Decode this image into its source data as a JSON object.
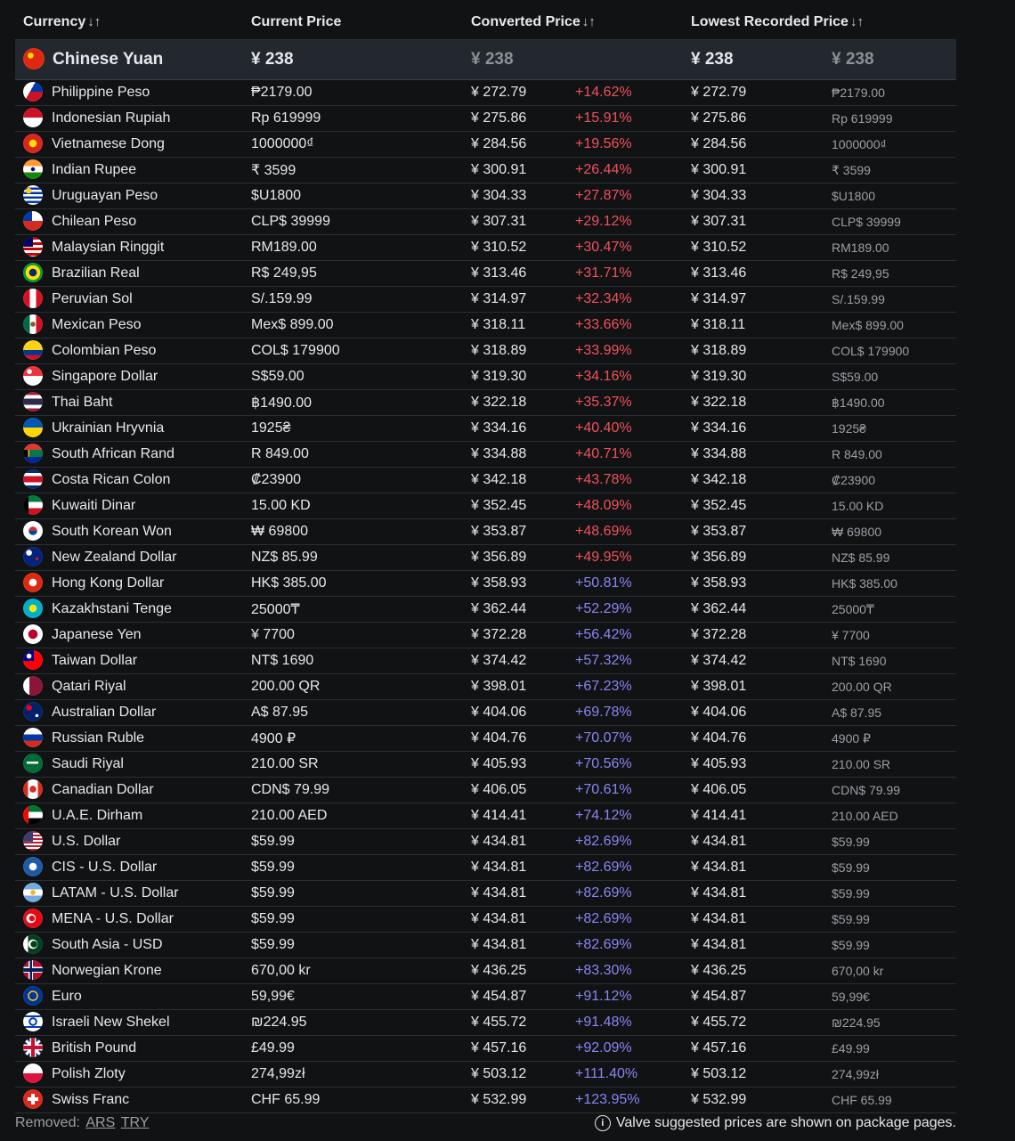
{
  "header": {
    "currency": "Currency",
    "current_price": "Current Price",
    "converted_price": "Converted Price",
    "lowest_recorded": "Lowest Recorded Price",
    "sort_icon": "↓↑"
  },
  "base": {
    "name": "Chinese Yuan",
    "price": "¥ 238",
    "converted": "¥ 238",
    "lowest": "¥ 238",
    "lowest_orig": "¥ 238",
    "flag_bg": "radial-gradient(circle at 35% 35%, #ffde00 0 3px, transparent 3.5px), #de2910"
  },
  "rows": [
    {
      "name": "Philippine Peso",
      "price": "₱2179.00",
      "converted": "¥ 272.79",
      "pct": "+14.62%",
      "lowest": "¥ 272.79",
      "lowest_orig": "₱2179.00",
      "color": "red",
      "flag_bg": "linear-gradient(120deg, #fff 0 40%, transparent 40%), linear-gradient(to bottom, #0038a8 50%, #ce1126 50%)"
    },
    {
      "name": "Indonesian Rupiah",
      "price": "Rp 619999",
      "converted": "¥ 275.86",
      "pct": "+15.91%",
      "lowest": "¥ 275.86",
      "lowest_orig": "Rp 619999",
      "color": "red",
      "flag_bg": "linear-gradient(to bottom, #ce1126 50%, #fff 50%)"
    },
    {
      "name": "Vietnamese Dong",
      "price": "1000000₫",
      "converted": "¥ 284.56",
      "pct": "+19.56%",
      "lowest": "¥ 284.56",
      "lowest_orig": "1000000₫",
      "color": "red",
      "flag_bg": "radial-gradient(circle, #ffde00 0 4px, transparent 4.5px), #da251d"
    },
    {
      "name": "Indian Rupee",
      "price": "₹ 3599",
      "converted": "¥ 300.91",
      "pct": "+26.44%",
      "lowest": "¥ 300.91",
      "lowest_orig": "₹ 3599",
      "color": "red",
      "flag_bg": "radial-gradient(circle, #06038d 0 2px, transparent 2.5px), linear-gradient(to bottom, #ff9933 33%, #fff 33% 66%, #138808 66%)"
    },
    {
      "name": "Uruguayan Peso",
      "price": "$U1800",
      "converted": "¥ 304.33",
      "pct": "+27.87%",
      "lowest": "¥ 304.33",
      "lowest_orig": "$U1800",
      "color": "red",
      "flag_bg": "radial-gradient(circle at 28% 28%, #fcd116 0 3px, transparent 3.5px), repeating-linear-gradient(to bottom, #fff 0 2.5px, #0038a8 2.5px 5px)"
    },
    {
      "name": "Chilean Peso",
      "price": "CLP$ 39999",
      "converted": "¥ 307.31",
      "pct": "+29.12%",
      "lowest": "¥ 307.31",
      "lowest_orig": "CLP$ 39999",
      "color": "red",
      "flag_bg": "linear-gradient(to right, #0039a6 45%, transparent 45%) top / 100% 50% no-repeat, linear-gradient(to bottom, #fff 50%, #d52b1e 50%)"
    },
    {
      "name": "Malaysian Ringgit",
      "price": "RM189.00",
      "converted": "¥ 310.52",
      "pct": "+30.47%",
      "lowest": "¥ 310.52",
      "lowest_orig": "RM189.00",
      "color": "red",
      "flag_bg": "linear-gradient(to right, #010066 50%, transparent 50%) top / 100% 50% no-repeat, repeating-linear-gradient(to bottom, #cc0001 0 3px, #fff 3px 6px)"
    },
    {
      "name": "Brazilian Real",
      "price": "R$ 249,95",
      "converted": "¥ 313.46",
      "pct": "+31.71%",
      "lowest": "¥ 313.46",
      "lowest_orig": "R$ 249,95",
      "color": "red",
      "flag_bg": "radial-gradient(circle, #002776 0 4px, #fedf00 4.5px 8px, #009c3b 8.5px)"
    },
    {
      "name": "Peruvian Sol",
      "price": "S/.159.99",
      "converted": "¥ 314.97",
      "pct": "+32.34%",
      "lowest": "¥ 314.97",
      "lowest_orig": "S/.159.99",
      "color": "red",
      "flag_bg": "linear-gradient(to right, #d91023 33%, #fff 33% 66%, #d91023 66%)"
    },
    {
      "name": "Mexican Peso",
      "price": "Mex$ 899.00",
      "converted": "¥ 318.11",
      "pct": "+33.66%",
      "lowest": "¥ 318.11",
      "lowest_orig": "Mex$ 899.00",
      "color": "red",
      "flag_bg": "radial-gradient(circle, #8b5a2b 0 2.5px, transparent 3px), linear-gradient(to right, #006847 33%, #fff 33% 66%, #ce1126 66%)"
    },
    {
      "name": "Colombian Peso",
      "price": "COL$ 179900",
      "converted": "¥ 318.89",
      "pct": "+33.99%",
      "lowest": "¥ 318.89",
      "lowest_orig": "COL$ 179900",
      "color": "red",
      "flag_bg": "linear-gradient(to bottom, #fcd116 50%, #003893 50% 75%, #ce1126 75%)"
    },
    {
      "name": "Singapore Dollar",
      "price": "S$59.00",
      "converted": "¥ 319.30",
      "pct": "+34.16%",
      "lowest": "¥ 319.30",
      "lowest_orig": "S$59.00",
      "color": "red",
      "flag_bg": "radial-gradient(circle at 32% 28%, #fff 0 2.5px, transparent 3px), linear-gradient(to bottom, #ef3340 50%, #fff 50%)"
    },
    {
      "name": "Thai Baht",
      "price": "฿1490.00",
      "converted": "¥ 322.18",
      "pct": "+35.37%",
      "lowest": "¥ 322.18",
      "lowest_orig": "฿1490.00",
      "color": "red",
      "flag_bg": "linear-gradient(to bottom, #a51931 16%, #fff 16% 33%, #2d2a4a 33% 66%, #fff 66% 83%, #a51931 83%)"
    },
    {
      "name": "Ukrainian Hryvnia",
      "price": "1925₴",
      "converted": "¥ 334.16",
      "pct": "+40.40%",
      "lowest": "¥ 334.16",
      "lowest_orig": "1925₴",
      "color": "red",
      "flag_bg": "linear-gradient(to bottom, #0057b7 50%, #ffd700 50%)"
    },
    {
      "name": "South African Rand",
      "price": "R 849.00",
      "converted": "¥ 334.88",
      "pct": "+40.71%",
      "lowest": "¥ 334.88",
      "lowest_orig": "R 849.00",
      "color": "red",
      "flag_bg": "linear-gradient(to right, #000 0 25%, #ffb612 25% 32%, #007a4d 32%) center / 100% 36% no-repeat, linear-gradient(to bottom, #de3831 50%, #002395 50%)"
    },
    {
      "name": "Costa Rican Colon",
      "price": "₡23900",
      "converted": "¥ 342.18",
      "pct": "+43.78%",
      "lowest": "¥ 342.18",
      "lowest_orig": "₡23900",
      "color": "red",
      "flag_bg": "linear-gradient(to bottom, #002b7f 18%, #fff 18% 33%, #ce1126 33% 66%, #fff 66% 82%, #002b7f 82%)"
    },
    {
      "name": "Kuwaiti Dinar",
      "price": "15.00 KD",
      "converted": "¥ 352.45",
      "pct": "+48.09%",
      "lowest": "¥ 352.45",
      "lowest_orig": "15.00 KD",
      "color": "red",
      "flag_bg": "linear-gradient(to right, #000 28%, transparent 28%), linear-gradient(to bottom, #007a3d 33%, #fff 33% 66%, #ce1126 66%)"
    },
    {
      "name": "South Korean Won",
      "price": "₩ 69800",
      "converted": "¥ 353.87",
      "pct": "+48.69%",
      "lowest": "¥ 353.87",
      "lowest_orig": "₩ 69800",
      "color": "red",
      "flag_bg": "radial-gradient(circle, transparent 0 4.5px, #fff 5px), linear-gradient(to bottom, #cd2e3a 50%, #0047a0 50%)"
    },
    {
      "name": "New Zealand Dollar",
      "price": "NZ$ 85.99",
      "converted": "¥ 356.89",
      "pct": "+49.95%",
      "lowest": "¥ 356.89",
      "lowest_orig": "NZ$ 85.99",
      "color": "red",
      "flag_bg": "radial-gradient(circle at 70% 60%, #cc142b 0 1.5px, transparent 2px), radial-gradient(circle at 30% 30%, #fff 0 3px, transparent 3.5px), #00247d"
    },
    {
      "name": "Hong Kong Dollar",
      "price": "HK$ 385.00",
      "converted": "¥ 358.93",
      "pct": "+50.81%",
      "lowest": "¥ 358.93",
      "lowest_orig": "HK$ 385.00",
      "color": "blue",
      "flag_bg": "radial-gradient(circle, #fff 0 4px, transparent 4.5px), #de2910"
    },
    {
      "name": "Kazakhstani Tenge",
      "price": "25000₸",
      "converted": "¥ 362.44",
      "pct": "+52.29%",
      "lowest": "¥ 362.44",
      "lowest_orig": "25000₸",
      "color": "blue",
      "flag_bg": "radial-gradient(circle, #ffe700 0 4px, transparent 4.5px), #00afca"
    },
    {
      "name": "Japanese Yen",
      "price": "¥ 7700",
      "converted": "¥ 372.28",
      "pct": "+56.42%",
      "lowest": "¥ 372.28",
      "lowest_orig": "¥ 7700",
      "color": "blue",
      "flag_bg": "radial-gradient(circle, #bc002d 0 5px, #fff 5.5px)"
    },
    {
      "name": "Taiwan Dollar",
      "price": "NT$ 1690",
      "converted": "¥ 374.42",
      "pct": "+57.32%",
      "lowest": "¥ 374.42",
      "lowest_orig": "NT$ 1690",
      "color": "blue",
      "flag_bg": "radial-gradient(circle at 30% 30%, #fff 0 2.5px, transparent 3px), linear-gradient(to right, #000095 55%, transparent 55%) top / 100% 55% no-repeat, #fe0000"
    },
    {
      "name": "Qatari Riyal",
      "price": "200.00 QR",
      "converted": "¥ 398.01",
      "pct": "+67.23%",
      "lowest": "¥ 398.01",
      "lowest_orig": "200.00 QR",
      "color": "blue",
      "flag_bg": "linear-gradient(to right, #fff 32%, #8a1538 32%)"
    },
    {
      "name": "Australian Dollar",
      "price": "A$ 87.95",
      "converted": "¥ 404.06",
      "pct": "+69.78%",
      "lowest": "¥ 404.06",
      "lowest_orig": "A$ 87.95",
      "color": "blue",
      "flag_bg": "radial-gradient(circle at 70% 70%, #fff 0 1.5px, transparent 2px), radial-gradient(circle at 30% 30%, #e4002b 0 3px, transparent 3.5px), #012169"
    },
    {
      "name": "Russian Ruble",
      "price": "4900 ₽",
      "converted": "¥ 404.76",
      "pct": "+70.07%",
      "lowest": "¥ 404.76",
      "lowest_orig": "4900 ₽",
      "color": "blue",
      "flag_bg": "linear-gradient(to bottom, #fff 33%, #0039a6 33% 66%, #d52b1e 66%)"
    },
    {
      "name": "Saudi Riyal",
      "price": "210.00 SR",
      "converted": "¥ 405.93",
      "pct": "+70.56%",
      "lowest": "¥ 405.93",
      "lowest_orig": "210.00 SR",
      "color": "blue",
      "flag_bg": "linear-gradient(to bottom, transparent 40%, #fff 40% 52%, transparent 52%) center / 60% 100% no-repeat, #006c35"
    },
    {
      "name": "Canadian Dollar",
      "price": "CDN$ 79.99",
      "converted": "¥ 406.05",
      "pct": "+70.61%",
      "lowest": "¥ 406.05",
      "lowest_orig": "CDN$ 79.99",
      "color": "blue",
      "flag_bg": "radial-gradient(circle, #d52b1e 0 3.5px, transparent 4px), linear-gradient(to right, #d52b1e 25%, #fff 25% 75%, #d52b1e 75%)"
    },
    {
      "name": "U.A.E. Dirham",
      "price": "210.00 AED",
      "converted": "¥ 414.41",
      "pct": "+74.12%",
      "lowest": "¥ 414.41",
      "lowest_orig": "210.00 AED",
      "color": "blue",
      "flag_bg": "linear-gradient(to right, #ff0000 28%, transparent 28%), linear-gradient(to bottom, #00732f 33%, #fff 33% 66%, #000 66%)"
    },
    {
      "name": "U.S. Dollar",
      "price": "$59.99",
      "converted": "¥ 434.81",
      "pct": "+82.69%",
      "lowest": "¥ 434.81",
      "lowest_orig": "$59.99",
      "color": "blue",
      "flag_bg": "linear-gradient(to right, #3c3b6e 50%, transparent 50%) top / 100% 54% no-repeat, repeating-linear-gradient(to bottom, #b22234 0 2px, #fff 2px 4px)"
    },
    {
      "name": "CIS - U.S. Dollar",
      "price": "$59.99",
      "converted": "¥ 434.81",
      "pct": "+82.69%",
      "lowest": "¥ 434.81",
      "lowest_orig": "$59.99",
      "color": "blue",
      "flag_bg": "radial-gradient(circle, #fff 0 4px, transparent 4.5px), #1e5aa8"
    },
    {
      "name": "LATAM - U.S. Dollar",
      "price": "$59.99",
      "converted": "¥ 434.81",
      "pct": "+82.69%",
      "lowest": "¥ 434.81",
      "lowest_orig": "$59.99",
      "color": "blue",
      "flag_bg": "radial-gradient(circle, #f6b40e 0 2.5px, transparent 3px), linear-gradient(to bottom, #74acdf 33%, #fff 33% 66%, #74acdf 66%)"
    },
    {
      "name": "MENA - U.S. Dollar",
      "price": "$59.99",
      "converted": "¥ 434.81",
      "pct": "+82.69%",
      "lowest": "¥ 434.81",
      "lowest_orig": "$59.99",
      "color": "blue",
      "flag_bg": "radial-gradient(circle at 45% 50%, #e30a17 0 3px, transparent 3.5px), radial-gradient(circle at 40% 50%, #fff 0 5px, transparent 5.5px), #e30a17"
    },
    {
      "name": "South Asia - USD",
      "price": "$59.99",
      "converted": "¥ 434.81",
      "pct": "+82.69%",
      "lowest": "¥ 434.81",
      "lowest_orig": "$59.99",
      "color": "blue",
      "flag_bg": "radial-gradient(circle at 55% 50%, #01411c 0 3.5px, transparent 4px), radial-gradient(circle at 50% 50%, #fff 0 5px, transparent 5.5px), linear-gradient(to right, #fff 25%, #01411c 25%)"
    },
    {
      "name": "Norwegian Krone",
      "price": "670,00 kr",
      "converted": "¥ 436.25",
      "pct": "+83.30%",
      "lowest": "¥ 436.25",
      "lowest_orig": "670,00 kr",
      "color": "blue",
      "flag_bg": "linear-gradient(to right, transparent 33%, #00205b 33% 45%, transparent 45%), linear-gradient(to bottom, transparent 40%, #00205b 40% 58%, transparent 58%), linear-gradient(to right, transparent 28%, #fff 28% 50%, transparent 50%), linear-gradient(to bottom, transparent 34%, #fff 34% 64%, transparent 64%), #ba0c2f"
    },
    {
      "name": "Euro",
      "price": "59,99€",
      "converted": "¥ 454.87",
      "pct": "+91.12%",
      "lowest": "¥ 454.87",
      "lowest_orig": "59,99€",
      "color": "blue",
      "flag_bg": "radial-gradient(circle, transparent 0 4px, #ffcc00 4.5px 5.5px, transparent 6px), #003399"
    },
    {
      "name": "Israeli New Shekel",
      "price": "₪224.95",
      "converted": "¥ 455.72",
      "pct": "+91.48%",
      "lowest": "¥ 455.72",
      "lowest_orig": "₪224.95",
      "color": "blue",
      "flag_bg": "radial-gradient(circle, #fff 0 2.5px, #0038b8 3px 4.5px, transparent 5px), linear-gradient(to bottom, #fff 18%, #0038b8 18% 28%, #fff 28% 72%, #0038b8 72% 82%, #fff 82%)"
    },
    {
      "name": "British Pound",
      "price": "£49.99",
      "converted": "¥ 457.16",
      "pct": "+92.09%",
      "lowest": "¥ 457.16",
      "lowest_orig": "£49.99",
      "color": "blue",
      "flag_bg": "linear-gradient(to right, transparent 42%, #c8102e 42% 58%, transparent 58%), linear-gradient(to bottom, transparent 42%, #c8102e 42% 58%, transparent 58%), linear-gradient(to right, transparent 35%, #fff 35% 65%, transparent 65%), linear-gradient(to bottom, transparent 35%, #fff 35% 65%, transparent 65%), linear-gradient(45deg, transparent 45%, #fff 45% 55%, transparent 55%), linear-gradient(-45deg, transparent 45%, #fff 45% 55%, transparent 55%), #012169"
    },
    {
      "name": "Polish Zloty",
      "price": "274,99zł",
      "converted": "¥ 503.12",
      "pct": "+111.40%",
      "lowest": "¥ 503.12",
      "lowest_orig": "274,99zł",
      "color": "blue",
      "flag_bg": "linear-gradient(to bottom, #fff 50%, #dc143c 50%)"
    },
    {
      "name": "Swiss Franc",
      "price": "CHF 65.99",
      "converted": "¥ 532.99",
      "pct": "+123.95%",
      "lowest": "¥ 532.99",
      "lowest_orig": "CHF 65.99",
      "color": "blue",
      "flag_bg": "linear-gradient(to right, transparent 40%, #fff 40% 60%, transparent 60%) center / 100% 56% no-repeat, linear-gradient(to bottom, transparent 40%, #fff 40% 60%, transparent 60%) center / 56% 100% no-repeat, #da291c"
    }
  ],
  "footer": {
    "removed_label": "Removed:",
    "removed_items": [
      "ARS",
      "TRY"
    ],
    "note_icon": "info-icon",
    "note": "Valve suggested prices are shown on package pages."
  },
  "colors": {
    "increase_low": "#f0525c",
    "increase_high": "#8a86f2"
  }
}
